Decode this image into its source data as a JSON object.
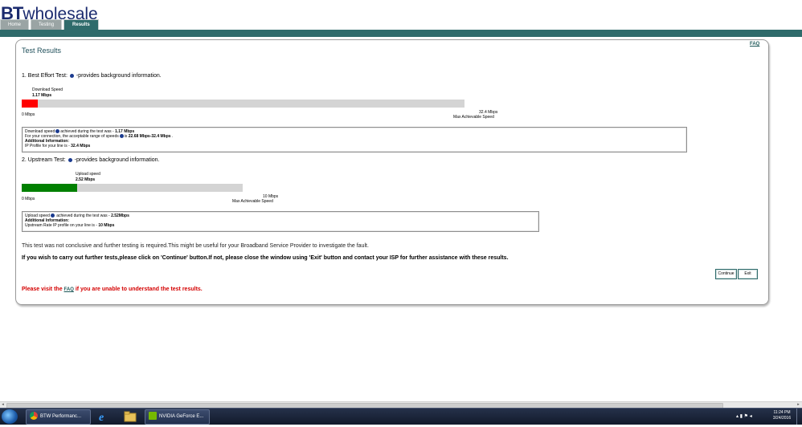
{
  "header": {
    "logo_bt": "BT",
    "logo_rest": "wholesale",
    "tabs": [
      {
        "label": "Home",
        "active": false
      },
      {
        "label": "Testing",
        "active": false
      },
      {
        "label": "Results",
        "active": true
      }
    ],
    "faq_link": "FAQ"
  },
  "panel": {
    "title": "Test Results"
  },
  "best_effort": {
    "heading_prefix": "1. Best Effort Test:",
    "heading_suffix": "-provides background information.",
    "speed_label": "Download Speed",
    "speed_value": "1.17 Mbps",
    "min_label": "0 Mbps",
    "max_value_label": "32.4 Mbps",
    "max_caption": "Max Achievable Speed",
    "fill_fraction": 0.036,
    "fill_color": "#ff0000",
    "info_line1_prefix": "Download speed",
    "info_line1_mid": "achieved during the test was - ",
    "info_line1_value": "1.17 Mbps",
    "info_line2_prefix": "For your connection, the acceptable range of speeds",
    "info_line2_mid": "is ",
    "info_line2_value": "22.68 Mbps-32.4 Mbps",
    "info_line2_suffix": " .",
    "info_line3": "Additional Information:",
    "info_line4_prefix": "IP Profile for your line is - ",
    "info_line4_value": "32.4 Mbps"
  },
  "upstream": {
    "heading_prefix": "2. Upstream Test:",
    "heading_suffix": "-provides background information.",
    "speed_label": "Upload speed",
    "speed_value": "2.52 Mbps",
    "min_label": "0 Mbps",
    "max_value_label": "10 Mbps",
    "max_caption": "Max Achievable Speed",
    "fill_fraction": 0.252,
    "fill_color": "#008000",
    "info_line1_prefix": "Upload speed",
    "info_line1_mid": " achieved during the test was - ",
    "info_line1_value": "2.52Mbps",
    "info_line2": "Additional Information:",
    "info_line3_prefix": "Upstream Rate IP profile on your line is - ",
    "info_line3_value": "10 Mbps"
  },
  "messages": {
    "inconclusive": "This test was not conclusive and further testing is required.This might be useful for your Broadband Service Provider to investigate the fault.",
    "instructions": "If you wish to carry out further tests,please click on 'Continue' button.If not, please close the window using 'Exit' button and contact your ISP for further assistance with these results.",
    "visit_prefix": "Please visit the ",
    "visit_link": "FAQ",
    "visit_suffix": " if you are unable to understand the test results."
  },
  "buttons": {
    "continue": "Continue",
    "exit": "Exit"
  },
  "taskbar": {
    "items": [
      {
        "label": "BTW Performanc...",
        "icon": "chrome-icon"
      },
      {
        "label": "",
        "icon": "internet-explorer-icon"
      },
      {
        "label": "",
        "icon": "folder-icon"
      },
      {
        "label": "NVIDIA GeForce E...",
        "icon": "nvidia-icon"
      }
    ],
    "time": "11:24 PM",
    "date": "3/24/2016"
  },
  "colors": {
    "teal": "#2f6b6b",
    "logo_blue": "#1a2a6e",
    "warning_red": "#d40000"
  }
}
